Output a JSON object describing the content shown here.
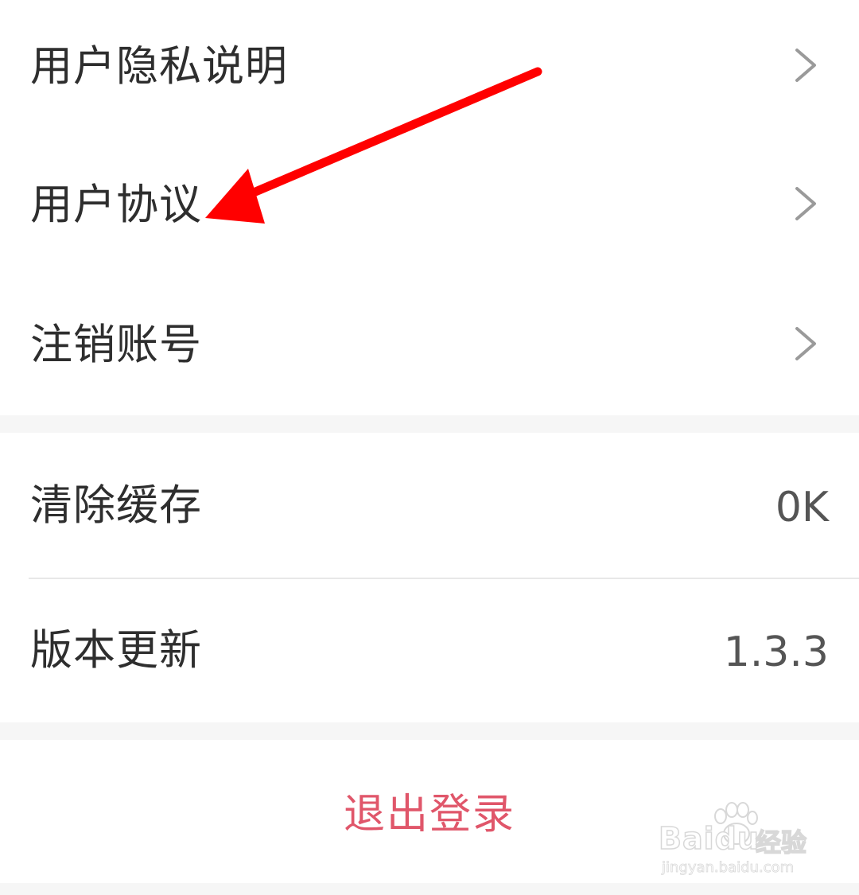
{
  "menu_group_1": {
    "items": [
      {
        "label": "用户隐私说明"
      },
      {
        "label": "用户协议"
      },
      {
        "label": "注销账号"
      }
    ]
  },
  "menu_group_2": {
    "items": [
      {
        "label": "清除缓存",
        "value": "0K"
      },
      {
        "label": "版本更新",
        "value": "1.3.3"
      }
    ]
  },
  "logout": {
    "label": "退出登录"
  },
  "watermark": {
    "brand": "Baidu",
    "brand_cn": "经验",
    "url": "jingyan.baidu.com"
  },
  "colors": {
    "logout_text": "#e0566a",
    "annotation_arrow": "#ff0000",
    "chevron": "#9a9a9a"
  },
  "icons": {
    "row_chevron": "chevron-right-icon",
    "annotation": "red-arrow-annotation"
  }
}
